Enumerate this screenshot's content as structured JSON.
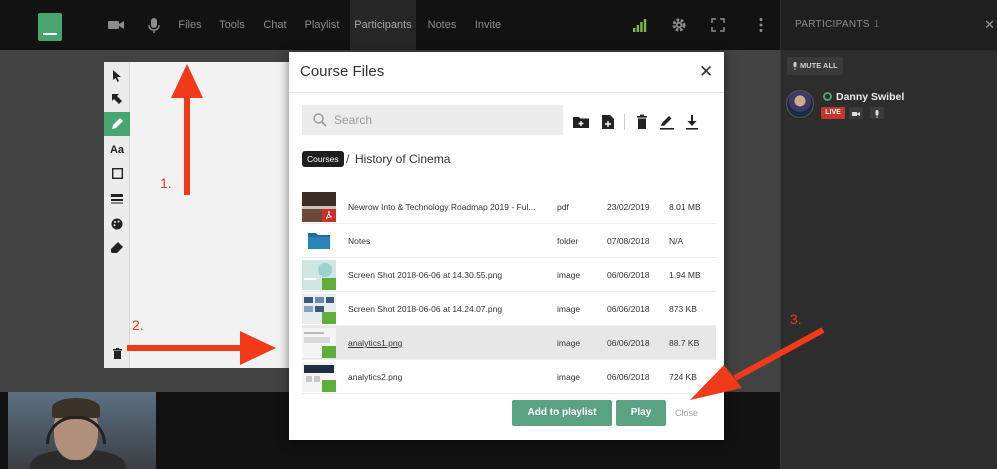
{
  "topbar": {
    "menu": [
      {
        "label": "Files"
      },
      {
        "label": "Tools"
      },
      {
        "label": "Chat"
      },
      {
        "label": "Playlist"
      },
      {
        "label": "Participants"
      },
      {
        "label": "Notes"
      },
      {
        "label": "Invite"
      }
    ],
    "active_menu": "Participants",
    "icons": [
      "camera-icon",
      "microphone-icon",
      "signal-icon",
      "gear-icon",
      "fullscreen-icon",
      "more-vertical-icon"
    ]
  },
  "participants_panel": {
    "title": "PARTICIPANTS",
    "count": "1",
    "mute_all_label": "MUTE ALL",
    "participant": {
      "name": "Danny Swibel",
      "live_badge": "LIVE"
    }
  },
  "whiteboard": {
    "tools": [
      "pointer-icon",
      "arrow-pointer-icon",
      "pencil-icon",
      "Aa",
      "rectangle-icon",
      "line-weight-icon",
      "palette-icon",
      "eraser-icon",
      "trash-icon"
    ],
    "selected_tool": "pencil-icon"
  },
  "modal": {
    "title": "Course Files",
    "search_placeholder": "Search",
    "breadcrumb": {
      "root": "Courses",
      "separator": "/",
      "current": "History of Cinema"
    },
    "files": [
      {
        "name": "Newrow Into & Technology Roadmap 2019 - Ful...",
        "type": "pdf",
        "date": "23/02/2019",
        "size": "8.01 MB"
      },
      {
        "name": "Notes",
        "type": "folder",
        "date": "07/08/2018",
        "size": "N/A"
      },
      {
        "name": "Screen Shot 2018-06-06 at 14.30.55.png",
        "type": "image",
        "date": "06/06/2018",
        "size": "1.94 MB"
      },
      {
        "name": "Screen Shot 2018-06-06 at 14.24.07.png",
        "type": "image",
        "date": "06/06/2018",
        "size": "873 KB"
      },
      {
        "name": "analytics1.png",
        "type": "image",
        "date": "06/06/2018",
        "size": "88.7 KB"
      },
      {
        "name": "analytics2.png",
        "type": "image",
        "date": "06/06/2018",
        "size": "724 KB"
      }
    ],
    "selected_file": "analytics1.png",
    "buttons": {
      "add_to_playlist": "Add to playlist",
      "play": "Play",
      "close": "Close"
    }
  },
  "annotations": {
    "labels": [
      "1.",
      "2.",
      "3."
    ],
    "color": "#f03a1a"
  },
  "colors": {
    "accent": "#49a56f",
    "button": "#5ba283",
    "live": "#c4352a"
  }
}
